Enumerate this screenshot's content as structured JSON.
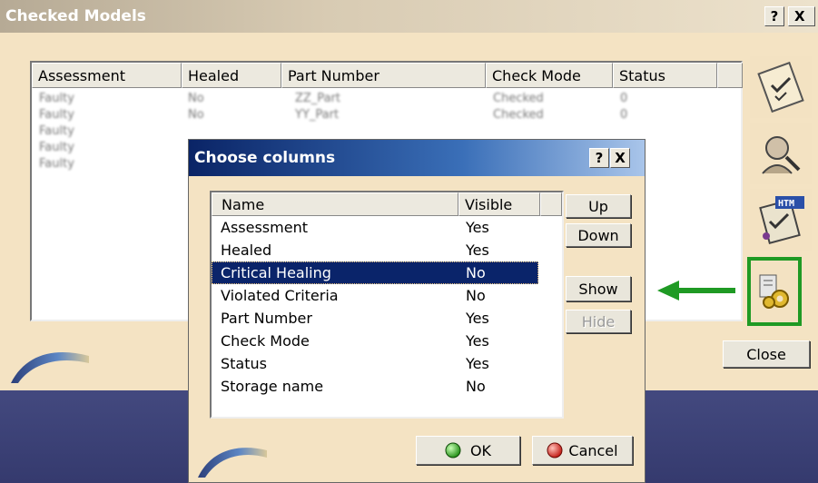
{
  "main_window": {
    "title": "Checked Models",
    "help_label": "?",
    "close_label": "X",
    "columns": [
      "Assessment",
      "Healed",
      "Part Number",
      "Check Mode",
      "Status"
    ],
    "rows": [
      {
        "assessment": "Faulty",
        "healed": "No",
        "part_number": "ZZ_Part",
        "check_mode": "Checked",
        "status": "0"
      },
      {
        "assessment": "Faulty",
        "healed": "No",
        "part_number": "YY_Part",
        "check_mode": "Checked",
        "status": "0"
      },
      {
        "assessment": "Faulty"
      },
      {
        "assessment": "Faulty"
      },
      {
        "assessment": "Faulty"
      }
    ],
    "close_button": "Close",
    "side_icons": [
      "check-report-icon",
      "search-person-icon",
      "html-report-icon",
      "settings-gear-icon"
    ],
    "highlight_color": "#1f9a24"
  },
  "dialog": {
    "title": "Choose columns",
    "help_label": "?",
    "close_label": "X",
    "headers": {
      "name": "Name",
      "visible": "Visible"
    },
    "rows": [
      {
        "name": "Assessment",
        "visible": "Yes"
      },
      {
        "name": "Healed",
        "visible": "Yes"
      },
      {
        "name": "Critical Healing",
        "visible": "No",
        "selected": true
      },
      {
        "name": "Violated Criteria",
        "visible": "No"
      },
      {
        "name": "Part Number",
        "visible": "Yes"
      },
      {
        "name": "Check Mode",
        "visible": "Yes"
      },
      {
        "name": "Status",
        "visible": "Yes"
      },
      {
        "name": "Storage name",
        "visible": "No"
      }
    ],
    "buttons": {
      "up": "Up",
      "down": "Down",
      "show": "Show",
      "hide": "Hide",
      "ok": "OK",
      "cancel": "Cancel"
    }
  }
}
